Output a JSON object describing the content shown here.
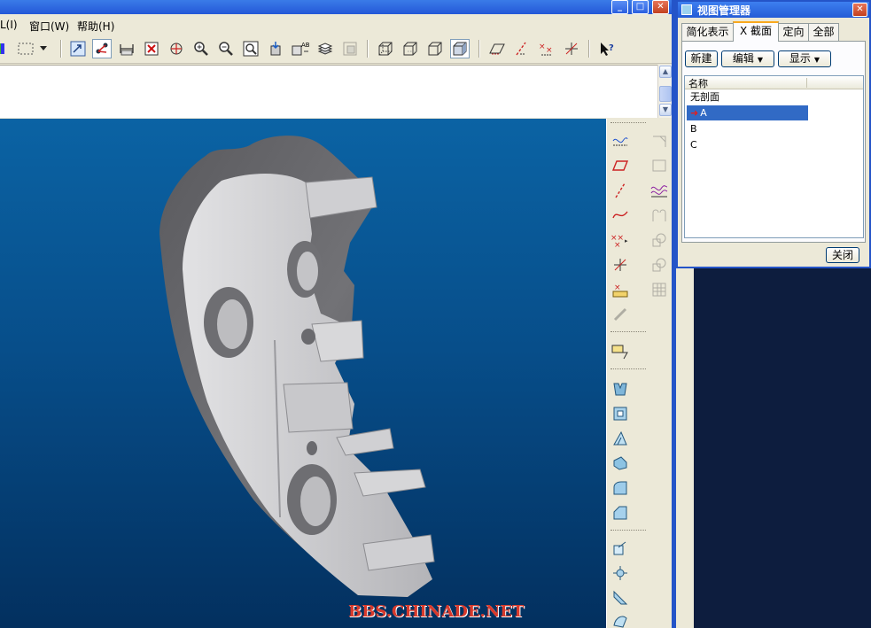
{
  "app": {
    "menu": [
      "L(I)",
      "窗口(W)",
      "帮助(H)"
    ],
    "toolbar_icons": [
      "color-swatch-icon",
      "box-select-icon",
      "dropdown-arrow-icon",
      "repaint-icon",
      "orient-icon",
      "measure-icon",
      "delete-icon",
      "spin-center-icon",
      "zoom-in-icon",
      "zoom-out-icon",
      "refit-icon",
      "view-mode-icon",
      "named-view-icon",
      "layers-icon",
      "model-display-icon",
      "wireframe-icon",
      "hidden-line-icon",
      "no-hidden-icon",
      "shading-icon",
      "datum-plane-icon",
      "datum-axis-icon",
      "datum-point-icon",
      "csys-icon",
      "help-whats-this-icon"
    ],
    "right_tools": [
      "sketch-icon",
      "plane-icon",
      "axis-icon",
      "curve-icon",
      "point-icon",
      "csys-icon",
      "analysis-icon",
      "chain-icon",
      "annotation-icon",
      "extrude-icon",
      "revolve-icon",
      "sweep-icon",
      "blend-icon",
      "round-icon",
      "chamfer-icon",
      "hole-icon",
      "rib-icon",
      "shell-icon",
      "draft-icon"
    ],
    "watermark": "BBS.CHINADE.NET"
  },
  "view_manager": {
    "title": "视图管理器",
    "tabs": [
      "简化表示",
      "X 截面",
      "定向",
      "全部"
    ],
    "active_tab": 1,
    "buttons": {
      "new": "新建",
      "edit": "编辑",
      "display": "显示"
    },
    "list_header": "名称",
    "rows": [
      {
        "label": "无剖面",
        "selected": false,
        "active_mark": false
      },
      {
        "label": "A",
        "selected": true,
        "active_mark": true
      },
      {
        "label": "B",
        "selected": false,
        "active_mark": false
      },
      {
        "label": "C",
        "selected": false,
        "active_mark": false
      }
    ],
    "close_button": "关闭"
  },
  "colors": {
    "viewport_top": "#0b63a4",
    "viewport_bottom": "#03305f",
    "selection": "#316ac5",
    "title_blue": "#2454c8"
  }
}
